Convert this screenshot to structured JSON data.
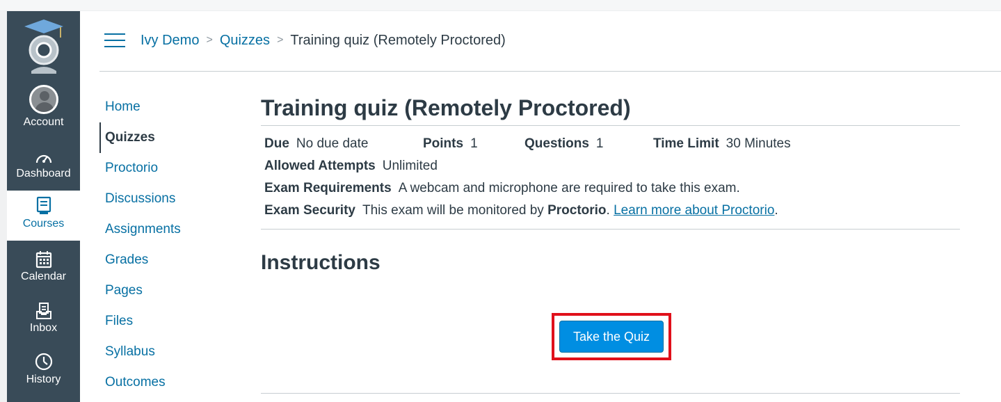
{
  "global_nav": {
    "items": [
      {
        "label": "Account",
        "icon": "account-avatar-icon"
      },
      {
        "label": "Dashboard",
        "icon": "dashboard-gauge-icon"
      },
      {
        "label": "Courses",
        "icon": "courses-book-icon",
        "active": true
      },
      {
        "label": "Calendar",
        "icon": "calendar-icon"
      },
      {
        "label": "Inbox",
        "icon": "inbox-icon"
      },
      {
        "label": "History",
        "icon": "history-clock-icon"
      }
    ]
  },
  "breadcrumb": {
    "course": "Ivy Demo",
    "section": "Quizzes",
    "current": "Training quiz (Remotely Proctored)",
    "separator": ">"
  },
  "course_nav": {
    "items": [
      {
        "label": "Home"
      },
      {
        "label": "Quizzes",
        "active": true
      },
      {
        "label": "Proctorio"
      },
      {
        "label": "Discussions"
      },
      {
        "label": "Assignments"
      },
      {
        "label": "Grades"
      },
      {
        "label": "Pages"
      },
      {
        "label": "Files"
      },
      {
        "label": "Syllabus"
      },
      {
        "label": "Outcomes"
      }
    ]
  },
  "quiz": {
    "title": "Training quiz (Remotely Proctored)",
    "due_label": "Due",
    "due_value": "No due date",
    "points_label": "Points",
    "points_value": "1",
    "questions_label": "Questions",
    "questions_value": "1",
    "time_limit_label": "Time Limit",
    "time_limit_value": "30 Minutes",
    "attempts_label": "Allowed Attempts",
    "attempts_value": "Unlimited",
    "requirements_label": "Exam Requirements",
    "requirements_value": "A webcam and microphone are required to take this exam.",
    "security_label": "Exam Security",
    "security_text_before": "This exam will be monitored by",
    "security_brand": "Proctorio",
    "security_period": ".",
    "security_link": "Learn more about Proctorio",
    "security_trailing": "."
  },
  "instructions": {
    "heading": "Instructions",
    "button_label": "Take the Quiz"
  },
  "colors": {
    "nav_bg": "#394b58",
    "link": "#0770a3",
    "button": "#008ee2",
    "highlight_box": "#e0101b"
  }
}
